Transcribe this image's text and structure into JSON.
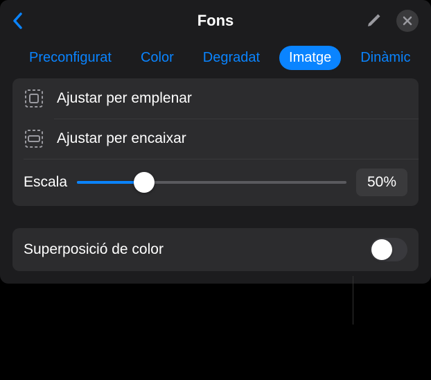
{
  "header": {
    "title": "Fons"
  },
  "tabs": {
    "items": [
      {
        "label": "Preconfigurat"
      },
      {
        "label": "Color"
      },
      {
        "label": "Degradat"
      },
      {
        "label": "Imatge"
      },
      {
        "label": "Dinàmic"
      }
    ],
    "activeIndex": 3
  },
  "fitOptions": {
    "fill": "Ajustar per emplenar",
    "fit": "Ajustar per encaixar"
  },
  "scale": {
    "label": "Escala",
    "value": "50%",
    "percent": 50
  },
  "overlay": {
    "label": "Superposició de color",
    "enabled": false
  }
}
